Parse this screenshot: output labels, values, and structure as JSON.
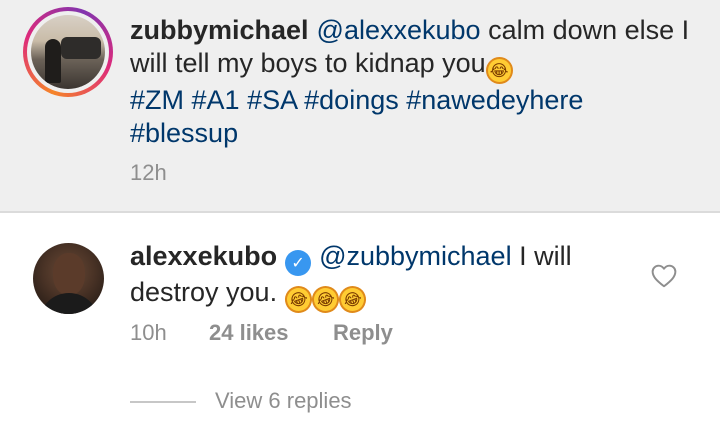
{
  "comments": [
    {
      "username": "zubbymichael",
      "mention": "@alexxekubo",
      "text": "calm down else I will tell my boys to kidnap you",
      "emoji": "face-with-tears-of-joy",
      "hashtags": [
        "#ZM",
        "#A1",
        "#SA",
        "#doings",
        "#nawedeyhere",
        "#blessup"
      ],
      "time": "12h",
      "avatar": "profile-photo-with-story-ring"
    },
    {
      "username": "alexxekubo",
      "verified": true,
      "mention": "@zubbymichael",
      "text": "I will destroy you.",
      "emojis": [
        "rolling-on-the-floor-laughing",
        "rolling-on-the-floor-laughing",
        "rolling-on-the-floor-laughing"
      ],
      "time": "10h",
      "likes": "24 likes",
      "reply_label": "Reply",
      "like_icon": "heart-outline-icon"
    }
  ],
  "view_replies": "View 6 replies",
  "colors": {
    "highlight_background": "#efefef",
    "link": "#00376b",
    "secondary_text": "#8e8e8e",
    "verified_badge": "#3897f0"
  }
}
